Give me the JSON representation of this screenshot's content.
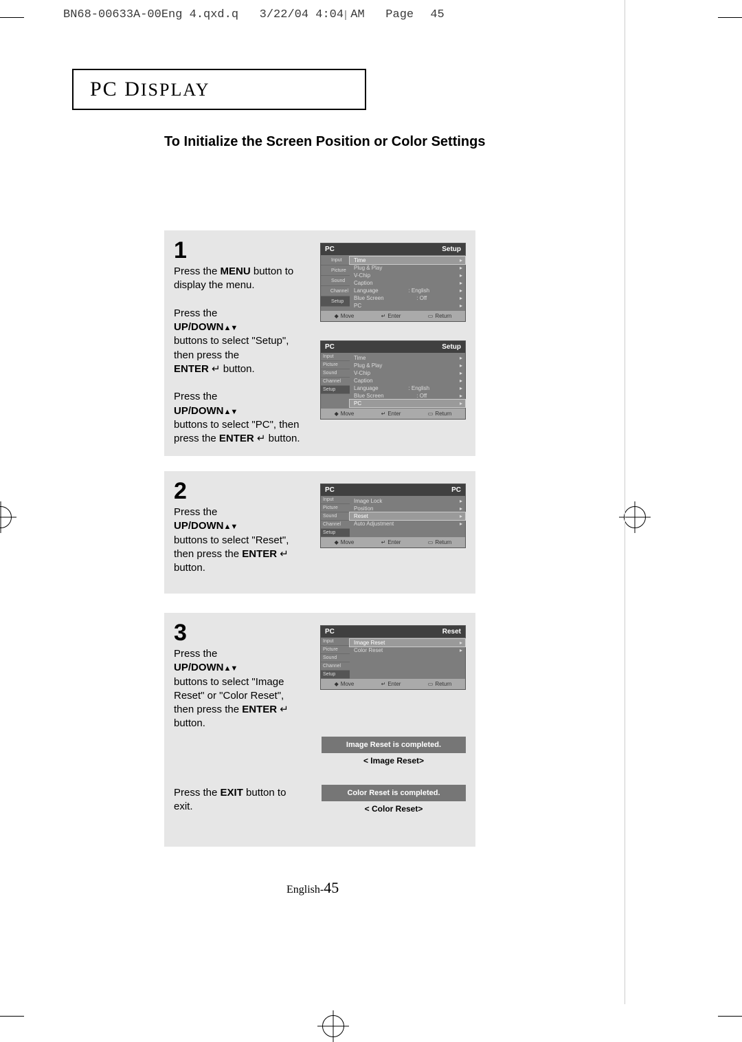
{
  "header": {
    "filename": "BN68-00633A-00Eng 4.qxd.q",
    "timestamp": "3/22/04 4:04 AM",
    "pageword": "Page",
    "pagenum": "45"
  },
  "section_title_leading": "PC D",
  "section_title_rest": "ISPLAY",
  "page_heading": "To Initialize the Screen Position or Color Settings",
  "steps": {
    "s1": {
      "num": "1",
      "para1a": "Press the ",
      "para1b_bold": "MENU",
      "para1c": " button to display the menu.",
      "para2a": "Press the ",
      "para2b_bold": "UP/DOWN",
      "para2c": " buttons to select \"Setup\", then press the ",
      "para2d_bold": "ENTER",
      "para2e": " button.",
      "para3a": "Press the ",
      "para3b_bold": "UP/DOWN",
      "para3c": " buttons to select \"PC\", then press the ",
      "para3d_bold": "ENTER",
      "para3e": " button."
    },
    "s2": {
      "num": "2",
      "a": "Press the ",
      "b_bold": "UP/DOWN",
      "c": " buttons to select \"Reset\", then press the ",
      "d_bold": "ENTER",
      "e": " button."
    },
    "s3": {
      "num": "3",
      "a": "Press the ",
      "b_bold": "UP/DOWN",
      "c": " buttons to select \"Image Reset\" or \"Color Reset\", then press the ",
      "d_bold": "ENTER",
      "e": " button.",
      "exit_a": "Press the ",
      "exit_b_bold": "EXIT",
      "exit_c": " button to exit."
    }
  },
  "osd": {
    "tabs": [
      "Input",
      "Picture",
      "Sound",
      "Channel",
      "Setup"
    ],
    "setup": {
      "title_left": "PC",
      "title_right": "Setup",
      "rows": [
        {
          "label": "Time",
          "value": "",
          "sel": true
        },
        {
          "label": "Plug & Play",
          "value": ""
        },
        {
          "label": "V-Chip",
          "value": ""
        },
        {
          "label": "Caption",
          "value": ""
        },
        {
          "label": "Language",
          "value": ":   English"
        },
        {
          "label": "Blue Screen",
          "value": ":   Off"
        },
        {
          "label": "PC",
          "value": ""
        }
      ]
    },
    "setup_pc": {
      "title_left": "PC",
      "title_right": "Setup",
      "rows": [
        {
          "label": "Time",
          "value": ""
        },
        {
          "label": "Plug & Play",
          "value": ""
        },
        {
          "label": "V-Chip",
          "value": ""
        },
        {
          "label": "Caption",
          "value": ""
        },
        {
          "label": "Language",
          "value": ":   English"
        },
        {
          "label": "Blue Screen",
          "value": ":   Off"
        },
        {
          "label": "PC",
          "value": "",
          "sel": true
        }
      ]
    },
    "pc_menu": {
      "title_left": "PC",
      "title_right": "PC",
      "rows": [
        {
          "label": "Image Lock",
          "value": ""
        },
        {
          "label": "Position",
          "value": ""
        },
        {
          "label": "Reset",
          "value": "",
          "sel": true
        },
        {
          "label": "Auto Adjustment",
          "value": ""
        }
      ]
    },
    "reset_menu": {
      "title_left": "PC",
      "title_right": "Reset",
      "rows": [
        {
          "label": "Image Reset",
          "value": "",
          "sel": true
        },
        {
          "label": "Color Reset",
          "value": ""
        }
      ]
    },
    "footer": {
      "move": "Move",
      "enter": "Enter",
      "return": "Return"
    }
  },
  "banners": {
    "image_reset_msg": "Image Reset is completed.",
    "image_reset_caption": "< Image Reset>",
    "color_reset_msg": "Color Reset is completed.",
    "color_reset_caption": "< Color Reset>"
  },
  "page_footer_label": "English-",
  "page_footer_num": "45"
}
